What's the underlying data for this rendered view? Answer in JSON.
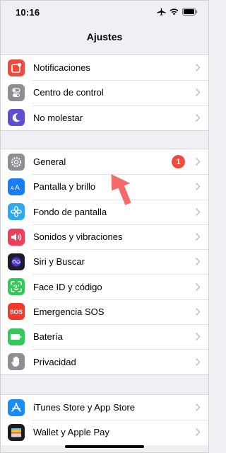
{
  "status_bar": {
    "time": "10:16"
  },
  "nav": {
    "title": "Ajustes"
  },
  "groups": [
    {
      "items": [
        {
          "label": "Notificaciones",
          "icon": "notifications-icon",
          "color": "#f04a3e"
        },
        {
          "label": "Centro de control",
          "icon": "control-center-icon",
          "color": "#8e8e93"
        },
        {
          "label": "No molestar",
          "icon": "moon-icon",
          "color": "#5b4fd6"
        }
      ]
    },
    {
      "items": [
        {
          "label": "General",
          "icon": "gear-icon",
          "color": "#8e8e93",
          "badge": "1"
        },
        {
          "label": "Pantalla y brillo",
          "icon": "display-icon",
          "color": "#1a7cf5"
        },
        {
          "label": "Fondo de pantalla",
          "icon": "wallpaper-icon",
          "color": "#2ea8ee"
        },
        {
          "label": "Sonidos y vibraciones",
          "icon": "speaker-icon",
          "color": "#f03d5b"
        },
        {
          "label": "Siri y Buscar",
          "icon": "siri-icon",
          "color": "#1b1b2a"
        },
        {
          "label": "Face ID y código",
          "icon": "face-id-icon",
          "color": "#34c759"
        },
        {
          "label": "Emergencia SOS",
          "icon": "sos-icon",
          "color": "#f0392e"
        },
        {
          "label": "Batería",
          "icon": "battery-icon",
          "color": "#34c759"
        },
        {
          "label": "Privacidad",
          "icon": "hand-icon",
          "color": "#8e8e93"
        }
      ]
    },
    {
      "items": [
        {
          "label": "iTunes Store y App Store",
          "icon": "app-store-icon",
          "color": "#1a8cf5"
        },
        {
          "label": "Wallet y Apple Pay",
          "icon": "wallet-icon",
          "color": "#1c1c1e"
        }
      ]
    }
  ],
  "badge_color": "#f2493a",
  "annotation_arrow_color": "#f26c6c"
}
